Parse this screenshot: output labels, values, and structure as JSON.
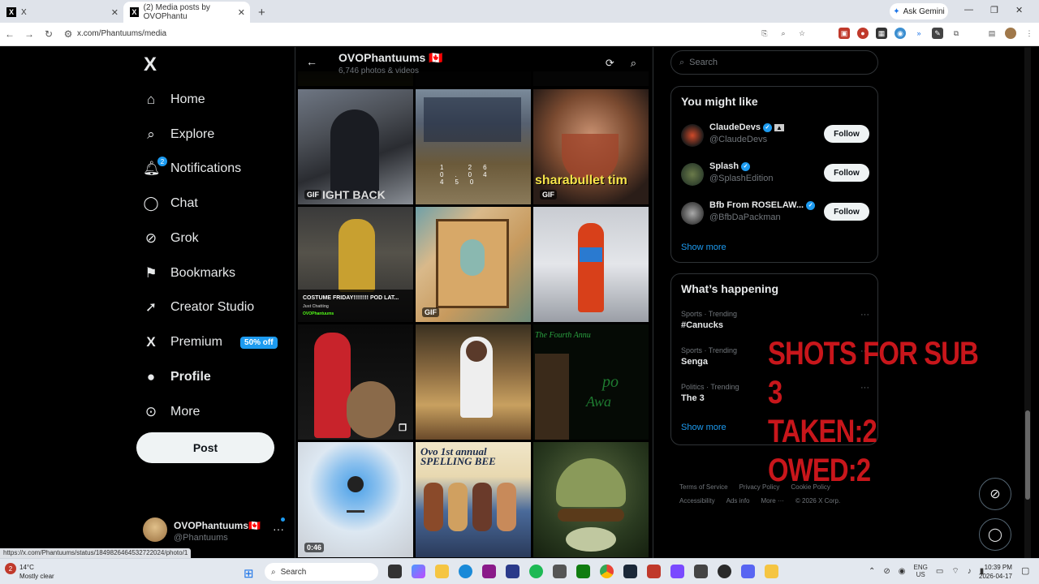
{
  "browser": {
    "tabs": [
      {
        "label": "X",
        "favicon": "X"
      },
      {
        "label": "(2) Media posts by OVOPhantu",
        "favicon": "X"
      }
    ],
    "new_tab": "+",
    "gemini": "Ask Gemini",
    "url": "x.com/Phantuums/media",
    "status_url": "https://x.com/Phantuums/status/1849826464532722024/photo/1"
  },
  "nav": {
    "logo": "X",
    "items": [
      {
        "label": "Home",
        "icon": "home-icon"
      },
      {
        "label": "Explore",
        "icon": "search-icon"
      },
      {
        "label": "Notifications",
        "icon": "bell-icon",
        "badge": "2"
      },
      {
        "label": "Chat",
        "icon": "chat-icon"
      },
      {
        "label": "Grok",
        "icon": "grok-icon"
      },
      {
        "label": "Bookmarks",
        "icon": "bookmark-icon"
      },
      {
        "label": "Creator Studio",
        "icon": "rocket-icon"
      },
      {
        "label": "Premium",
        "icon": "x-icon",
        "badge": "50% off"
      },
      {
        "label": "Profile",
        "icon": "person-icon"
      },
      {
        "label": "More",
        "icon": "more-icon"
      }
    ],
    "post_label": "Post",
    "account": {
      "name": "OVOPhantuums🇨🇦",
      "handle": "@Phantuums"
    }
  },
  "profile_header": {
    "name": "OVOPhantuums",
    "flag": "🇨🇦",
    "subtitle": "6,746 photos & videos"
  },
  "media": [
    {
      "label": "GIF",
      "caption": "IGHT BACK"
    },
    {
      "label": "",
      "caption": ""
    },
    {
      "label": "GIF",
      "caption": "sharabullet tim"
    },
    {
      "label": "",
      "caption": "COSTUME FRIDAY!!!!!!!! POD LAT..."
    },
    {
      "label": "GIF",
      "caption": ""
    },
    {
      "label": "",
      "caption": ""
    },
    {
      "label": "",
      "caption": ""
    },
    {
      "label": "",
      "caption": ""
    },
    {
      "label": "",
      "caption": "The Fourth Annu"
    },
    {
      "label": "0:46",
      "caption": ""
    },
    {
      "label": "",
      "caption": "Ovo 1st annual SPELLING BEE"
    },
    {
      "label": "",
      "caption": ""
    }
  ],
  "right": {
    "search_placeholder": "Search",
    "you_might_like": {
      "title": "You might like",
      "suggestions": [
        {
          "name": "ClaudeDevs",
          "handle": "@ClaudeDevs",
          "button": "Follow"
        },
        {
          "name": "Splash",
          "handle": "@SplashEdition",
          "button": "Follow"
        },
        {
          "name": "Bfb From ROSELAW...",
          "handle": "@BfbDaPackman",
          "button": "Follow"
        }
      ],
      "show_more": "Show more"
    },
    "whats_happening": {
      "title": "What’s happening",
      "trends": [
        {
          "context": "Sports · Trending",
          "topic": "#Canucks"
        },
        {
          "context": "Sports · Trending",
          "topic": "Senga"
        },
        {
          "context": "Politics · Trending",
          "topic": "The 3"
        }
      ],
      "show_more": "Show more"
    },
    "footer": [
      "Terms of Service",
      "Privacy Policy",
      "Cookie Policy",
      "Accessibility",
      "Ads info",
      "More ···",
      "© 2026 X Corp."
    ]
  },
  "overlay": {
    "line1": "SHOTS FOR SUB 3",
    "line2": "TAKEN:2",
    "line3": "OWED:2"
  },
  "taskbar": {
    "temp": "14°C",
    "weather": "Mostly clear",
    "weather_badge": "2",
    "search": "Search",
    "lang1": "ENG",
    "lang2": "US",
    "time": "10:39 PM",
    "date": "2026-04-17"
  },
  "colors": {
    "accent": "#1d9bf0",
    "overlay": "#c8161b",
    "background": "#000000"
  }
}
